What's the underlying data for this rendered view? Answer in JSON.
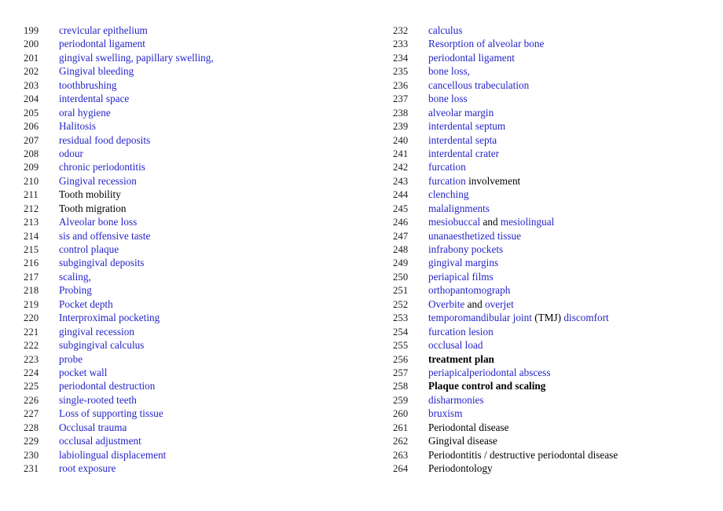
{
  "document": {
    "type": "index-list",
    "colors": {
      "link_blue": "#2424c8",
      "text_black": "#000000",
      "number_gray": "#1a1a1a",
      "background": "#ffffff"
    },
    "columns": [
      {
        "name": "left-column",
        "entries": [
          {
            "number": "199",
            "style": "blue",
            "segments": [
              {
                "text": "crevicular epithelium",
                "color": "blue"
              }
            ]
          },
          {
            "number": "200",
            "style": "blue",
            "segments": [
              {
                "text": "periodontal ligament",
                "color": "blue"
              }
            ]
          },
          {
            "number": "201",
            "style": "blue",
            "segments": [
              {
                "text": "gingival swelling, papillary swelling,",
                "color": "blue"
              }
            ]
          },
          {
            "number": "202",
            "style": "blue",
            "segments": [
              {
                "text": "Gingival bleeding",
                "color": "blue"
              }
            ]
          },
          {
            "number": "203",
            "style": "blue",
            "segments": [
              {
                "text": "toothbrushing",
                "color": "blue"
              }
            ]
          },
          {
            "number": "204",
            "style": "blue",
            "segments": [
              {
                "text": "interdental space",
                "color": "blue"
              }
            ]
          },
          {
            "number": "205",
            "style": "blue",
            "segments": [
              {
                "text": "oral hygiene",
                "color": "blue"
              }
            ]
          },
          {
            "number": "206",
            "style": "blue",
            "segments": [
              {
                "text": "Halitosis",
                "color": "blue"
              }
            ]
          },
          {
            "number": "207",
            "style": "blue",
            "segments": [
              {
                "text": "residual food deposits",
                "color": "blue"
              }
            ]
          },
          {
            "number": "208",
            "style": "blue",
            "segments": [
              {
                "text": "odour",
                "color": "blue"
              }
            ]
          },
          {
            "number": "209",
            "style": "blue",
            "segments": [
              {
                "text": "chronic periodontitis",
                "color": "blue"
              }
            ]
          },
          {
            "number": "210",
            "style": "blue",
            "segments": [
              {
                "text": "Gingival recession",
                "color": "blue"
              }
            ]
          },
          {
            "number": "211",
            "style": "black",
            "segments": [
              {
                "text": "Tooth mobility",
                "color": "black"
              }
            ]
          },
          {
            "number": "212",
            "style": "black",
            "segments": [
              {
                "text": "Tooth migration",
                "color": "black"
              }
            ]
          },
          {
            "number": "213",
            "style": "blue",
            "segments": [
              {
                "text": "Alveolar bone loss",
                "color": "blue"
              }
            ]
          },
          {
            "number": "214",
            "style": "blue",
            "segments": [
              {
                "text": "sis and offensive taste",
                "color": "blue"
              }
            ]
          },
          {
            "number": "215",
            "style": "blue",
            "segments": [
              {
                "text": "control plaque",
                "color": "blue"
              }
            ]
          },
          {
            "number": "216",
            "style": "blue",
            "segments": [
              {
                "text": "subgingival deposits",
                "color": "blue"
              }
            ]
          },
          {
            "number": "217",
            "style": "blue",
            "segments": [
              {
                "text": "scaling,",
                "color": "blue"
              }
            ]
          },
          {
            "number": "218",
            "style": "blue",
            "segments": [
              {
                "text": "Probing",
                "color": "blue"
              }
            ]
          },
          {
            "number": "219",
            "style": "blue",
            "segments": [
              {
                "text": "Pocket depth",
                "color": "blue"
              }
            ]
          },
          {
            "number": "220",
            "style": "blue",
            "segments": [
              {
                "text": "Interproximal pocketing",
                "color": "blue"
              }
            ]
          },
          {
            "number": "221",
            "style": "blue",
            "segments": [
              {
                "text": "gingival recession",
                "color": "blue"
              }
            ]
          },
          {
            "number": "222",
            "style": "blue",
            "segments": [
              {
                "text": "subgingival calculus",
                "color": "blue"
              }
            ]
          },
          {
            "number": "223",
            "style": "blue",
            "segments": [
              {
                "text": "probe",
                "color": "blue"
              }
            ]
          },
          {
            "number": "224",
            "style": "blue",
            "segments": [
              {
                "text": "pocket wall",
                "color": "blue"
              }
            ]
          },
          {
            "number": "225",
            "style": "blue",
            "segments": [
              {
                "text": "periodontal destruction",
                "color": "blue"
              }
            ]
          },
          {
            "number": "226",
            "style": "blue",
            "segments": [
              {
                "text": "single-rooted teeth",
                "color": "blue"
              }
            ]
          },
          {
            "number": "227",
            "style": "blue",
            "segments": [
              {
                "text": "Loss of supporting tissue",
                "color": "blue"
              }
            ]
          },
          {
            "number": "228",
            "style": "blue",
            "segments": [
              {
                "text": "Occlusal trauma",
                "color": "blue"
              }
            ]
          },
          {
            "number": "229",
            "style": "blue",
            "segments": [
              {
                "text": "occlusal adjustment",
                "color": "blue"
              }
            ]
          },
          {
            "number": "230",
            "style": "blue",
            "segments": [
              {
                "text": "labiolingual displacement",
                "color": "blue"
              }
            ]
          },
          {
            "number": "231",
            "style": "blue",
            "segments": [
              {
                "text": "root exposure",
                "color": "blue"
              }
            ]
          }
        ]
      },
      {
        "name": "right-column",
        "entries": [
          {
            "number": "232",
            "style": "blue",
            "segments": [
              {
                "text": "calculus",
                "color": "blue"
              }
            ]
          },
          {
            "number": "233",
            "style": "blue",
            "segments": [
              {
                "text": "Resorption of alveolar bone",
                "color": "blue"
              }
            ]
          },
          {
            "number": "234",
            "style": "blue",
            "segments": [
              {
                "text": "periodontal ligament",
                "color": "blue"
              }
            ]
          },
          {
            "number": "235",
            "style": "blue",
            "segments": [
              {
                "text": "bone loss,",
                "color": "blue"
              }
            ]
          },
          {
            "number": "236",
            "style": "blue",
            "segments": [
              {
                "text": "cancellous trabeculation",
                "color": "blue"
              }
            ]
          },
          {
            "number": "237",
            "style": "blue",
            "segments": [
              {
                "text": "bone loss",
                "color": "blue"
              }
            ]
          },
          {
            "number": "238",
            "style": "blue",
            "segments": [
              {
                "text": "alveolar margin",
                "color": "blue"
              }
            ]
          },
          {
            "number": "239",
            "style": "blue",
            "segments": [
              {
                "text": "interdental septum",
                "color": "blue"
              }
            ]
          },
          {
            "number": "240",
            "style": "blue",
            "segments": [
              {
                "text": "interdental septa",
                "color": "blue"
              }
            ]
          },
          {
            "number": "241",
            "style": "blue",
            "segments": [
              {
                "text": "interdental crater",
                "color": "blue"
              }
            ]
          },
          {
            "number": "242",
            "style": "blue",
            "segments": [
              {
                "text": "furcation",
                "color": "blue"
              }
            ]
          },
          {
            "number": "243",
            "style": "mixed",
            "segments": [
              {
                "text": "furcation",
                "color": "blue"
              },
              {
                "text": " involvement",
                "color": "black"
              }
            ]
          },
          {
            "number": "244",
            "style": "blue",
            "segments": [
              {
                "text": "clenching",
                "color": "blue"
              }
            ]
          },
          {
            "number": "245",
            "style": "blue",
            "segments": [
              {
                "text": "malalignments",
                "color": "blue"
              }
            ]
          },
          {
            "number": "246",
            "style": "mixed",
            "segments": [
              {
                "text": "mesiobuccal",
                "color": "blue"
              },
              {
                "text": " and ",
                "color": "black"
              },
              {
                "text": "mesiolingual",
                "color": "blue"
              }
            ]
          },
          {
            "number": "247",
            "style": "blue",
            "segments": [
              {
                "text": "unanaesthetized tissue",
                "color": "blue"
              }
            ]
          },
          {
            "number": "248",
            "style": "blue",
            "segments": [
              {
                "text": "infrabony pockets",
                "color": "blue"
              }
            ]
          },
          {
            "number": "249",
            "style": "blue",
            "segments": [
              {
                "text": "gingival margins",
                "color": "blue"
              }
            ]
          },
          {
            "number": "250",
            "style": "blue",
            "segments": [
              {
                "text": "periapical films",
                "color": "blue"
              }
            ]
          },
          {
            "number": "251",
            "style": "blue",
            "segments": [
              {
                "text": "orthopantomograph",
                "color": "blue"
              }
            ]
          },
          {
            "number": "252",
            "style": "mixed",
            "segments": [
              {
                "text": "Overbite",
                "color": "blue"
              },
              {
                "text": " and ",
                "color": "black"
              },
              {
                "text": "overjet",
                "color": "blue"
              }
            ]
          },
          {
            "number": "253",
            "style": "mixed",
            "segments": [
              {
                "text": "temporomandibular joint",
                "color": "blue"
              },
              {
                "text": " (TMJ) ",
                "color": "black"
              },
              {
                "text": "discomfort",
                "color": "blue"
              }
            ]
          },
          {
            "number": "254",
            "style": "blue",
            "segments": [
              {
                "text": "furcation lesion",
                "color": "blue"
              }
            ]
          },
          {
            "number": "255",
            "style": "blue",
            "segments": [
              {
                "text": "occlusal load",
                "color": "blue"
              }
            ]
          },
          {
            "number": "256",
            "style": "bold",
            "segments": [
              {
                "text": "treatment plan",
                "color": "black"
              }
            ]
          },
          {
            "number": "257",
            "style": "blue",
            "segments": [
              {
                "text": "periapicalperiodontal abscess",
                "color": "blue"
              }
            ]
          },
          {
            "number": "258",
            "style": "bold",
            "segments": [
              {
                "text": "Plaque control and scaling",
                "color": "black"
              }
            ]
          },
          {
            "number": "259",
            "style": "blue",
            "segments": [
              {
                "text": "disharmonies",
                "color": "blue"
              }
            ]
          },
          {
            "number": "260",
            "style": "blue",
            "segments": [
              {
                "text": "bruxism",
                "color": "blue"
              }
            ]
          },
          {
            "number": "261",
            "style": "black",
            "segments": [
              {
                "text": "Periodontal disease",
                "color": "black"
              }
            ]
          },
          {
            "number": "262",
            "style": "black",
            "segments": [
              {
                "text": "Gingival disease",
                "color": "black"
              }
            ]
          },
          {
            "number": "263",
            "style": "black",
            "segments": [
              {
                "text": "Periodontitis / destructive periodontal disease",
                "color": "black"
              }
            ]
          },
          {
            "number": "264",
            "style": "black",
            "segments": [
              {
                "text": "Periodontology",
                "color": "black"
              }
            ]
          }
        ]
      }
    ]
  }
}
